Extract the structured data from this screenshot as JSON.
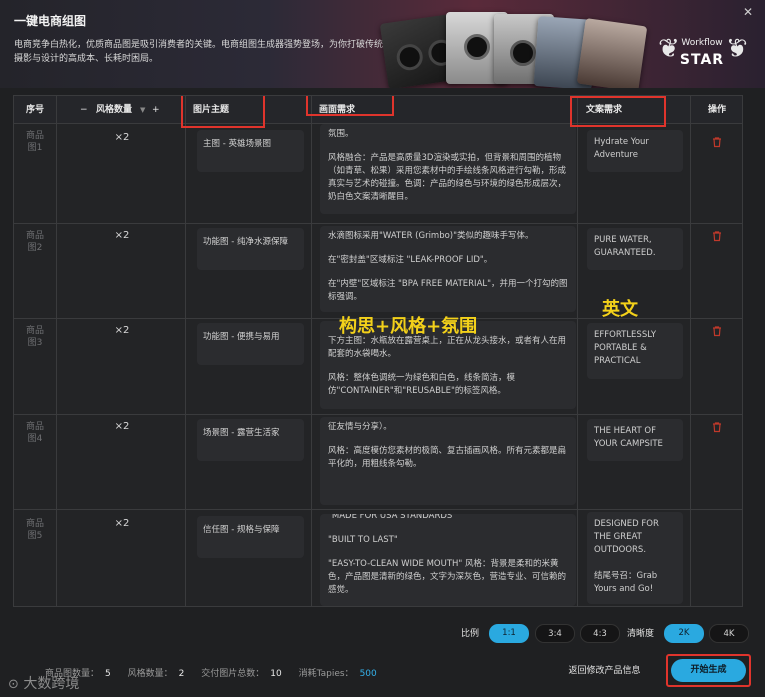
{
  "header": {
    "title": "一键电商组图",
    "description": "电商竞争白热化，优质商品图是吸引消费者的关键。电商组图生成器强势登场，为你打破传统摄影与设计的高成本、长耗时困局。",
    "badge_line1": "Workflow",
    "badge_line2": "STAR",
    "close_icon": "close-icon"
  },
  "table": {
    "headers": {
      "seq": "序号",
      "style_count": "风格数量",
      "minus": "−",
      "plus": "+",
      "image_topic": "图片主题",
      "scene_req": "画面需求",
      "copy_req": "文案需求",
      "action": "操作"
    },
    "rows": [
      {
        "seq": "商品图1",
        "count": "×2",
        "topic": "主图 - 英雄场景图",
        "scene": [
          "氛围。",
          "风格融合：产品是高质量3D渲染或实拍，但背景和周围的植物（如青草、松果）采用您素材中的手绘线条风格进行勾勒，形成真实与艺术的碰撞。色调：产品的绿色与环境的绿色形成层次，奶白色文案清晰醒目。"
        ],
        "copy": "Hydrate Your Adventure"
      },
      {
        "seq": "商品图2",
        "count": "×2",
        "topic": "功能图 - 纯净水源保障",
        "scene": [
          "水滴图标采用\"WATER (Grimbo)\"类似的趣味手写体。",
          "在\"密封盖\"区域标注 \"LEAK-PROOF LID\"。",
          "在\"内壁\"区域标注 \"BPA FREE MATERIAL\"，并用一个打勾的图标强调。"
        ],
        "copy": "PURE WATER, GUARANTEED."
      },
      {
        "seq": "商品图3",
        "count": "×2",
        "topic": "功能图 - 便携与易用",
        "scene": [
          "下方主图：水瓶放在露营桌上，正在从龙头接水，或者有人在用配套的水袋喝水。",
          "风格：整体色调统一为绿色和白色，线条简洁，模仿\"CONTAINER\"和\"REUSABLE\"的标签风格。"
        ],
        "copy": "EFFORTLESSLY PORTABLE & PRACTICAL"
      },
      {
        "seq": "商品图4",
        "count": "×2",
        "topic": "场景图 - 露营生活家",
        "scene": [
          "征友情与分享）。",
          "风格：高度模仿您素材的极简、复古插画风格。所有元素都是扁平化的，用粗线条勾勒。"
        ],
        "copy": "THE HEART OF YOUR CAMPSITE"
      },
      {
        "seq": "商品图5",
        "count": "×2",
        "topic": "信任图 - 规格与保障",
        "scene": [
          "\"MADE FOR USA STANDARDS\"",
          "\"BUILT TO LAST\"",
          "\"EASY-TO-CLEAN WIDE MOUTH\" 风格：背景是柔和的米黄色，产品图是清新的绿色，文字为深灰色，营造专业、可信赖的感觉。"
        ],
        "copy": "DESIGNED FOR THE GREAT OUTDOORS.\n\n结尾号召：Grab Yours and Go!"
      }
    ]
  },
  "annotations": {
    "scene_note": "构思+风格+氛围",
    "copy_note": "英文",
    "color": "#f3d11a"
  },
  "options": {
    "ratio_label": "比例",
    "ratios": [
      "1:1",
      "3:4",
      "4:3"
    ],
    "ratio_selected": "1:1",
    "clarity_label": "清晰度",
    "clarities": [
      "2K",
      "4K"
    ],
    "clarity_selected": "2K"
  },
  "footer": {
    "product_count_label": "商品图数量：",
    "product_count": "5",
    "style_count_label": "风格数量：",
    "style_count": "2",
    "total_label": "交付图片总数：",
    "total": "10",
    "cost_label": "消耗Tapies：",
    "cost": "500",
    "back_button": "返回修改产品信息",
    "generate_button": "开始生成",
    "watermark": "大数跨境"
  },
  "colors": {
    "accent": "#2aa9e0",
    "highlight_box": "#e0342c",
    "trash": "#c0392b"
  }
}
